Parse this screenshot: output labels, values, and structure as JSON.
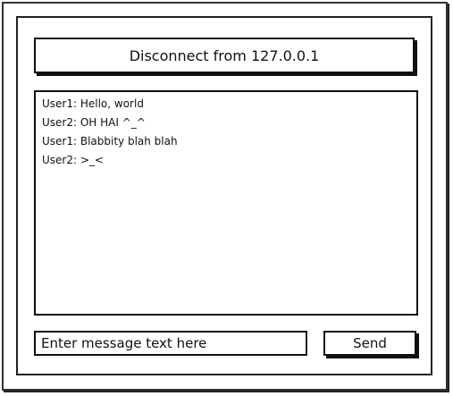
{
  "header": {
    "disconnect_label": "Disconnect from 127.0.0.1"
  },
  "chat": {
    "messages": [
      "User1: Hello, world",
      "User2: OH HAI ^_^",
      "User1: Blabbity blah blah",
      "User2: >_<"
    ]
  },
  "composer": {
    "input_value": "Enter message text here",
    "send_label": "Send"
  }
}
